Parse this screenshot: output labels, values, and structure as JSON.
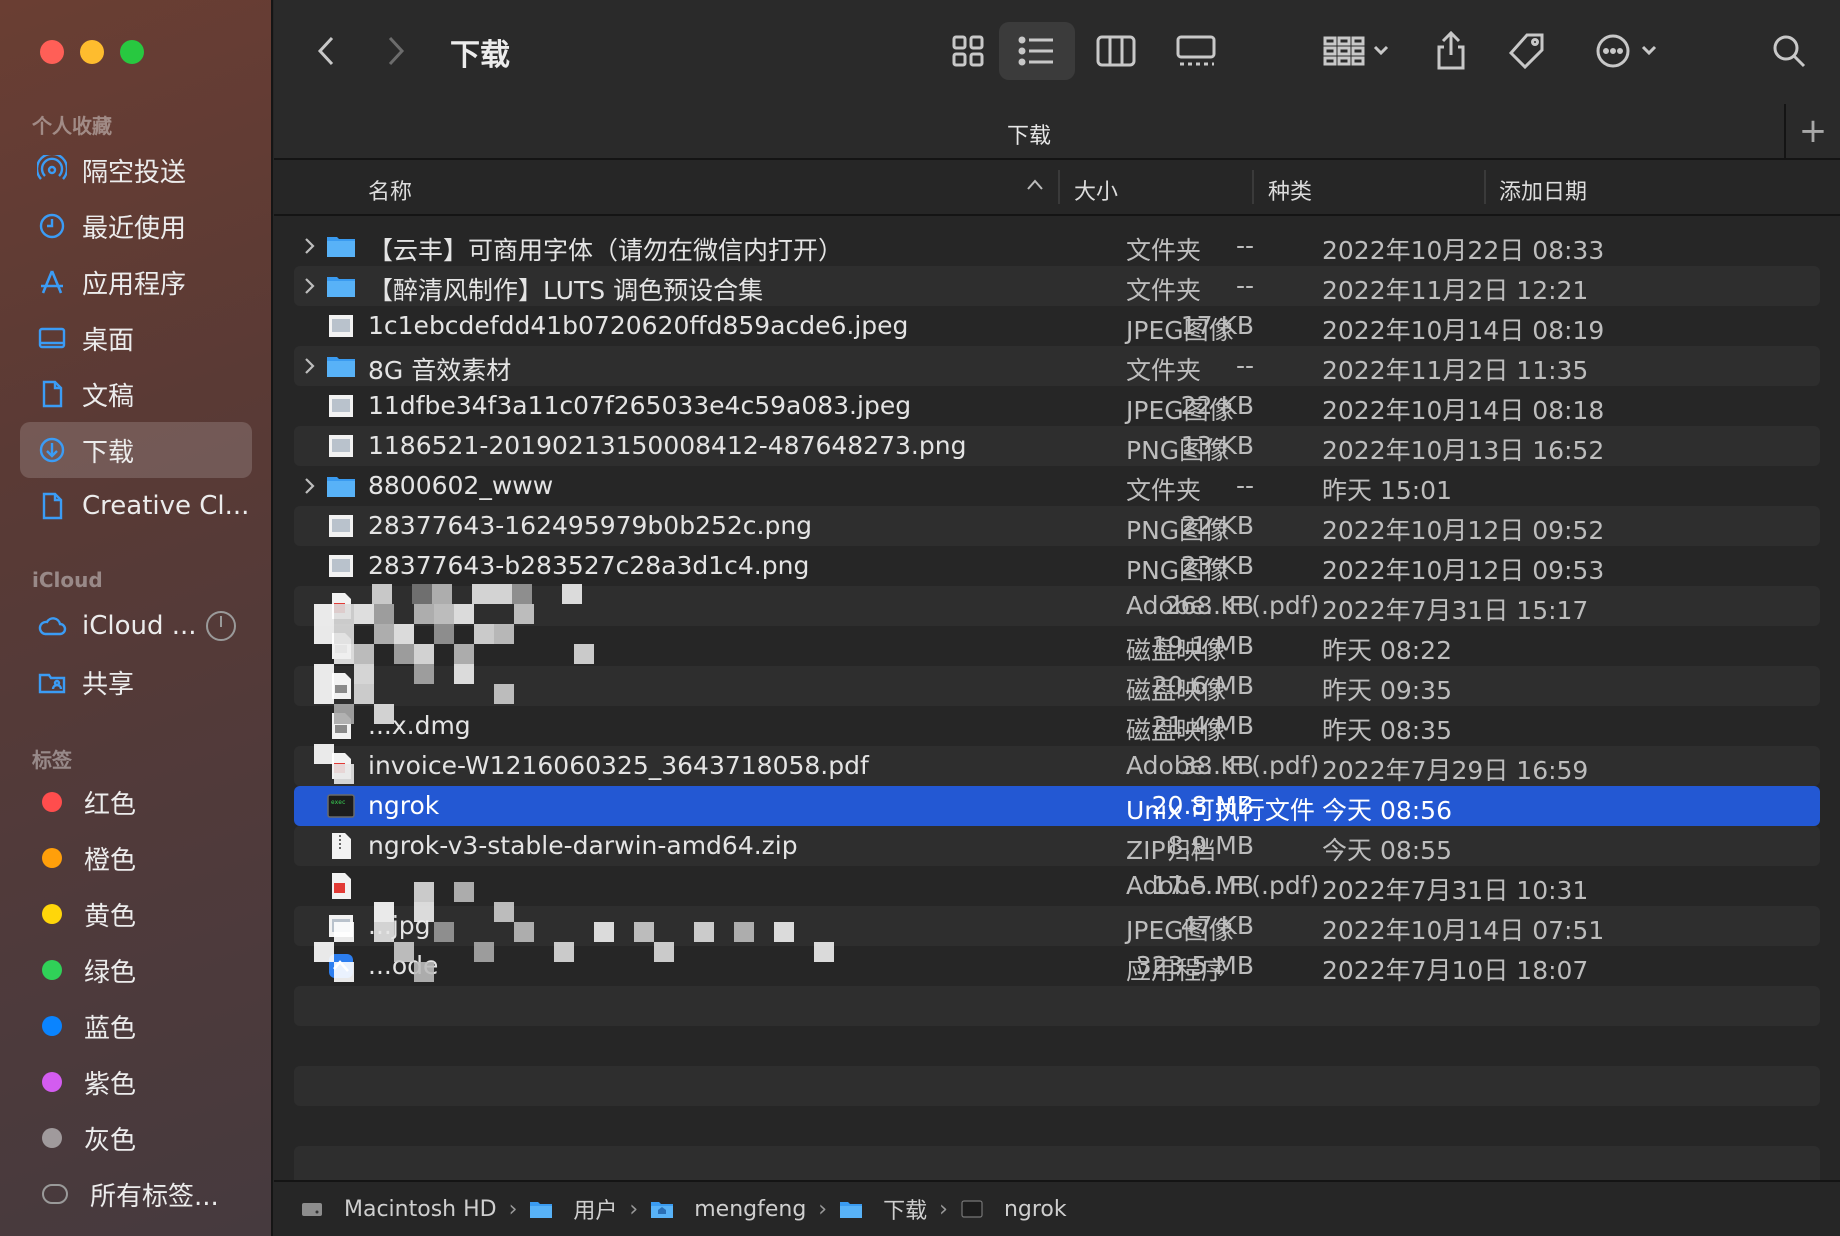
{
  "window": {
    "title": "下载"
  },
  "colors": {
    "accent": "#2358d3",
    "folder": "#3a9bf0"
  },
  "sidebar": {
    "favorites_header": "个人收藏",
    "favorites": [
      {
        "label": "隔空投送",
        "icon": "airdrop-icon"
      },
      {
        "label": "最近使用",
        "icon": "clock-icon"
      },
      {
        "label": "应用程序",
        "icon": "applications-icon"
      },
      {
        "label": "桌面",
        "icon": "desktop-icon"
      },
      {
        "label": "文稿",
        "icon": "document-icon"
      },
      {
        "label": "下载",
        "icon": "download-icon",
        "active": true
      },
      {
        "label": "Creative Cl...",
        "icon": "file-icon"
      }
    ],
    "icloud_header": "iCloud",
    "icloud": [
      {
        "label": "iCloud ...",
        "icon": "cloud-icon"
      },
      {
        "label": "共享",
        "icon": "shared-folder-icon"
      }
    ],
    "tags_header": "标签",
    "tags": [
      {
        "label": "红色",
        "color": "#ff4d4d"
      },
      {
        "label": "橙色",
        "color": "#ff9f0a"
      },
      {
        "label": "黄色",
        "color": "#ffd60a"
      },
      {
        "label": "绿色",
        "color": "#30d158"
      },
      {
        "label": "蓝色",
        "color": "#0a84ff"
      },
      {
        "label": "紫色",
        "color": "#d35cf0"
      },
      {
        "label": "灰色",
        "color": "#a09a9c"
      },
      {
        "label": "所有标签...",
        "color": ""
      }
    ]
  },
  "toolbar": {
    "title": "下载"
  },
  "tabbar": {
    "title": "下载",
    "add_label": "+"
  },
  "columns": {
    "name": "名称",
    "size": "大小",
    "kind": "种类",
    "date": "添加日期"
  },
  "files": [
    {
      "name": "【云丰】可商用字体（请勿在微信内打开）",
      "size": "--",
      "kind": "文件夹",
      "date": "2022年10月22日 08:33",
      "type": "folder"
    },
    {
      "name": "【醉清风制作】LUTS 调色预设合集",
      "size": "--",
      "kind": "文件夹",
      "date": "2022年11月2日 12:21",
      "type": "folder"
    },
    {
      "name": "1c1ebcdefdd41b0720620ffd859acde6.jpeg",
      "size": "17 KB",
      "kind": "JPEG图像",
      "date": "2022年10月14日 08:19",
      "type": "image"
    },
    {
      "name": "8G 音效素材",
      "size": "--",
      "kind": "文件夹",
      "date": "2022年11月2日 11:35",
      "type": "folder"
    },
    {
      "name": "11dfbe34f3a11c07f265033e4c59a083.jpeg",
      "size": "22 KB",
      "kind": "JPEG图像",
      "date": "2022年10月14日 08:18",
      "type": "image"
    },
    {
      "name": "1186521-20190213150008412-487648273.png",
      "size": "13 KB",
      "kind": "PNG图像",
      "date": "2022年10月13日 16:52",
      "type": "image"
    },
    {
      "name": "8800602_www",
      "size": "--",
      "kind": "文件夹",
      "date": "昨天 15:01",
      "type": "folder"
    },
    {
      "name": "28377643-162495979b0b252c.png",
      "size": "22 KB",
      "kind": "PNG图像",
      "date": "2022年10月12日 09:52",
      "type": "image"
    },
    {
      "name": "28377643-b283527c28a3d1c4.png",
      "size": "23 KB",
      "kind": "PNG图像",
      "date": "2022年10月12日 09:53",
      "type": "image"
    },
    {
      "name": "",
      "size": "268 KB",
      "kind": "Adobe...F (.pdf)",
      "date": "2022年7月31日 15:17",
      "type": "pdf"
    },
    {
      "name": "",
      "size": "19.1 MB",
      "kind": "磁盘映像",
      "date": "昨天 08:22",
      "type": "dmg"
    },
    {
      "name": "",
      "size": "20.6 MB",
      "kind": "磁盘映像",
      "date": "昨天 09:35",
      "type": "dmg"
    },
    {
      "name": "...x.dmg",
      "size": "21.4 MB",
      "kind": "磁盘映像",
      "date": "昨天 08:35",
      "type": "dmg"
    },
    {
      "name": "invoice-W1216060325_3643718058.pdf",
      "size": "38 KB",
      "kind": "Adobe...F (.pdf)",
      "date": "2022年7月29日 16:59",
      "type": "pdf"
    },
    {
      "name": "ngrok",
      "size": "20.8 MB",
      "kind": "Unix 可执行文件",
      "date": "今天 08:56",
      "type": "exec",
      "selected": true
    },
    {
      "name": "ngrok-v3-stable-darwin-amd64.zip",
      "size": "8.9 MB",
      "kind": "ZIP归档",
      "date": "今天 08:55",
      "type": "zip"
    },
    {
      "name": "",
      "size": "17.5 MB",
      "kind": "Adobe...F (.pdf)",
      "date": "2022年7月31日 10:31",
      "type": "pdf"
    },
    {
      "name": "...jpg",
      "size": "47 KB",
      "kind": "JPEG图像",
      "date": "2022年10月14日 07:51",
      "type": "image"
    },
    {
      "name": "...ode",
      "size": "323.5 MB",
      "kind": "应用程序",
      "date": "2022年7月10日 18:07",
      "type": "app"
    }
  ],
  "pathbar": [
    {
      "label": "Macintosh HD",
      "icon": "hard-drive-icon"
    },
    {
      "label": "用户",
      "icon": "folder-icon"
    },
    {
      "label": "mengfeng",
      "icon": "home-folder-icon"
    },
    {
      "label": "下载",
      "icon": "folder-icon"
    },
    {
      "label": "ngrok",
      "icon": "terminal-icon"
    }
  ]
}
